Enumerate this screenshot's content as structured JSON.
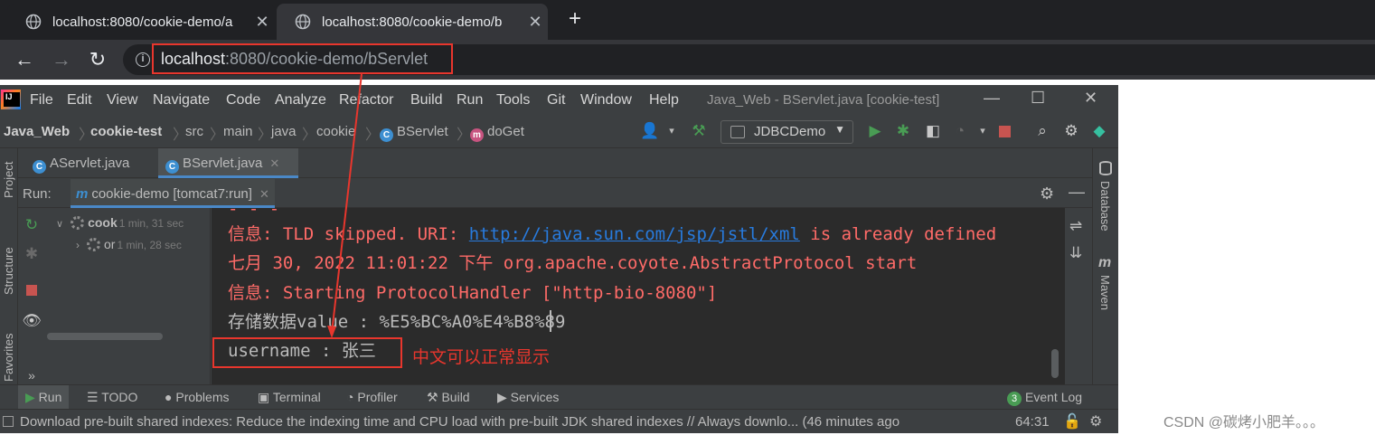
{
  "browser": {
    "tabs": [
      {
        "title": "localhost:8080/cookie-demo/a",
        "active": false
      },
      {
        "title": "localhost:8080/cookie-demo/b",
        "active": true
      }
    ],
    "new_tab": "+",
    "url_host": "localhost",
    "url_rest": ":8080/cookie-demo/bServlet"
  },
  "ide": {
    "menu": [
      "File",
      "Edit",
      "View",
      "Navigate",
      "Code",
      "Analyze",
      "Refactor",
      "Build",
      "Run",
      "Tools",
      "Git",
      "Window",
      "Help"
    ],
    "window_title": "Java_Web - BServlet.java [cookie-test]",
    "breadcrumbs": [
      "Java_Web",
      "cookie-test",
      "src",
      "main",
      "java",
      "cookie",
      "BServlet",
      "doGet"
    ],
    "run_config": "JDBCDemo",
    "editor_tabs": [
      "AServlet.java",
      "BServlet.java"
    ],
    "left_tools": [
      "Project",
      "Structure",
      "Favorites"
    ],
    "right_tools": [
      "Database",
      "Maven"
    ],
    "run_label": "Run:",
    "run_tab": "cookie-demo [tomcat7:run]",
    "tree": [
      {
        "label": "cook",
        "meta": "1 min, 31 sec"
      },
      {
        "label": "or",
        "meta": "1 min, 28 sec"
      }
    ],
    "console": {
      "line1_prefix": "信息: TLD skipped. URI: ",
      "line1_link": "http://java.sun.com/jsp/jstl/xml",
      "line1_suffix": " is already defined",
      "line2": "七月 30, 2022 11:01:22 下午 org.apache.coyote.AbstractProtocol start",
      "line3": "信息: Starting ProtocolHandler [\"http-bio-8080\"]",
      "line4": "存储数据value : %E5%BC%A0%E4%B8%89",
      "line5": "username : 张三"
    },
    "annotation": "中文可以正常显示",
    "bottom_tools": [
      "Run",
      "TODO",
      "Problems",
      "Terminal",
      "Profiler",
      "Build",
      "Services"
    ],
    "event_log": {
      "count": "3",
      "label": "Event Log"
    },
    "status_message": "Download pre-built shared indexes: Reduce the indexing time and CPU load with pre-built JDK shared indexes // Always downlo... (46 minutes ago",
    "caret_position": "64:31"
  },
  "watermark": "CSDN @碳烤小肥羊。。。"
}
